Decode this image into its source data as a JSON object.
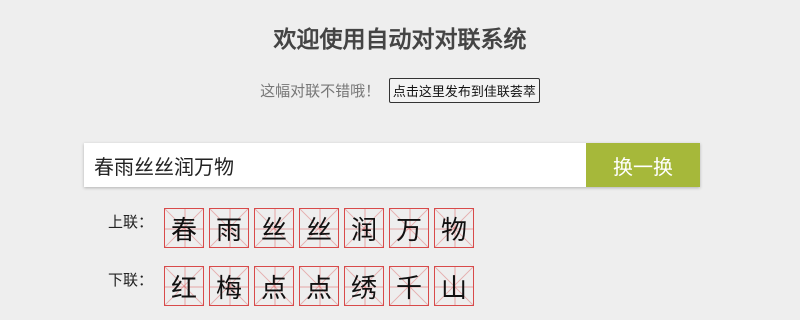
{
  "header": {
    "title": "欢迎使用自动对对联系统"
  },
  "share": {
    "text": "这幅对联不错哦！",
    "button_label": "点击这里发布到佳联荟萃"
  },
  "input": {
    "value": "春雨丝丝润万物",
    "button_label": "换一换"
  },
  "couplet": {
    "upper_label": "上联：",
    "lower_label": "下联：",
    "upper_chars": [
      "春",
      "雨",
      "丝",
      "丝",
      "润",
      "万",
      "物"
    ],
    "lower_chars": [
      "红",
      "梅",
      "点",
      "点",
      "绣",
      "千",
      "山"
    ]
  },
  "colors": {
    "accent_button": "#a6b83a",
    "grid_line": "#d84a4a",
    "background": "#eeeeee"
  }
}
